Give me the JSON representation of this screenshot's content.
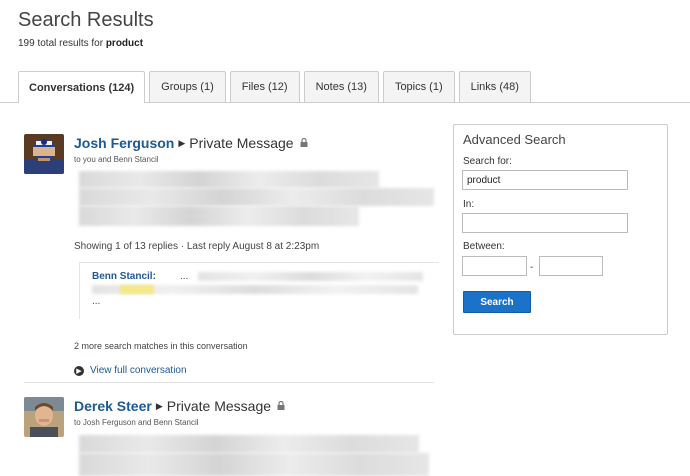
{
  "header": {
    "title": "Search Results",
    "summary_prefix": "199 total results for",
    "query": "product"
  },
  "tabs": [
    {
      "label": "Conversations (124)",
      "active": true
    },
    {
      "label": "Groups (1)",
      "active": false
    },
    {
      "label": "Files (12)",
      "active": false
    },
    {
      "label": "Notes (13)",
      "active": false
    },
    {
      "label": "Topics (1)",
      "active": false
    },
    {
      "label": "Links (48)",
      "active": false
    }
  ],
  "results": [
    {
      "author": "Josh Ferguson",
      "type": "Private Message",
      "recipients": "to you and Benn Stancil",
      "replies_info": "Showing 1 of 13 replies · Last reply August 8 at 2:23pm",
      "reply": {
        "author": "Benn Stancil:",
        "ellipsis": "...",
        "ellipsis_end": "..."
      },
      "more_matches": "2 more search matches in this conversation",
      "view_full": "View full conversation",
      "icons": [
        "lock-icon",
        "arrow-right-icon",
        "circle-arrow-icon"
      ]
    },
    {
      "author": "Derek Steer",
      "type": "Private Message",
      "recipients": "to Josh Ferguson and Benn Stancil",
      "icons": [
        "lock-icon",
        "arrow-right-icon"
      ]
    }
  ],
  "advanced_search": {
    "title": "Advanced Search",
    "search_for_label": "Search for:",
    "search_for_value": "product",
    "in_label": "In:",
    "in_value": "",
    "between_label": "Between:",
    "between_from": "",
    "between_to": "",
    "dash": "-",
    "button_label": "Search"
  },
  "colors": {
    "link": "#1d5a95",
    "button": "#1a73c8",
    "highlight": "#f3e98a"
  }
}
